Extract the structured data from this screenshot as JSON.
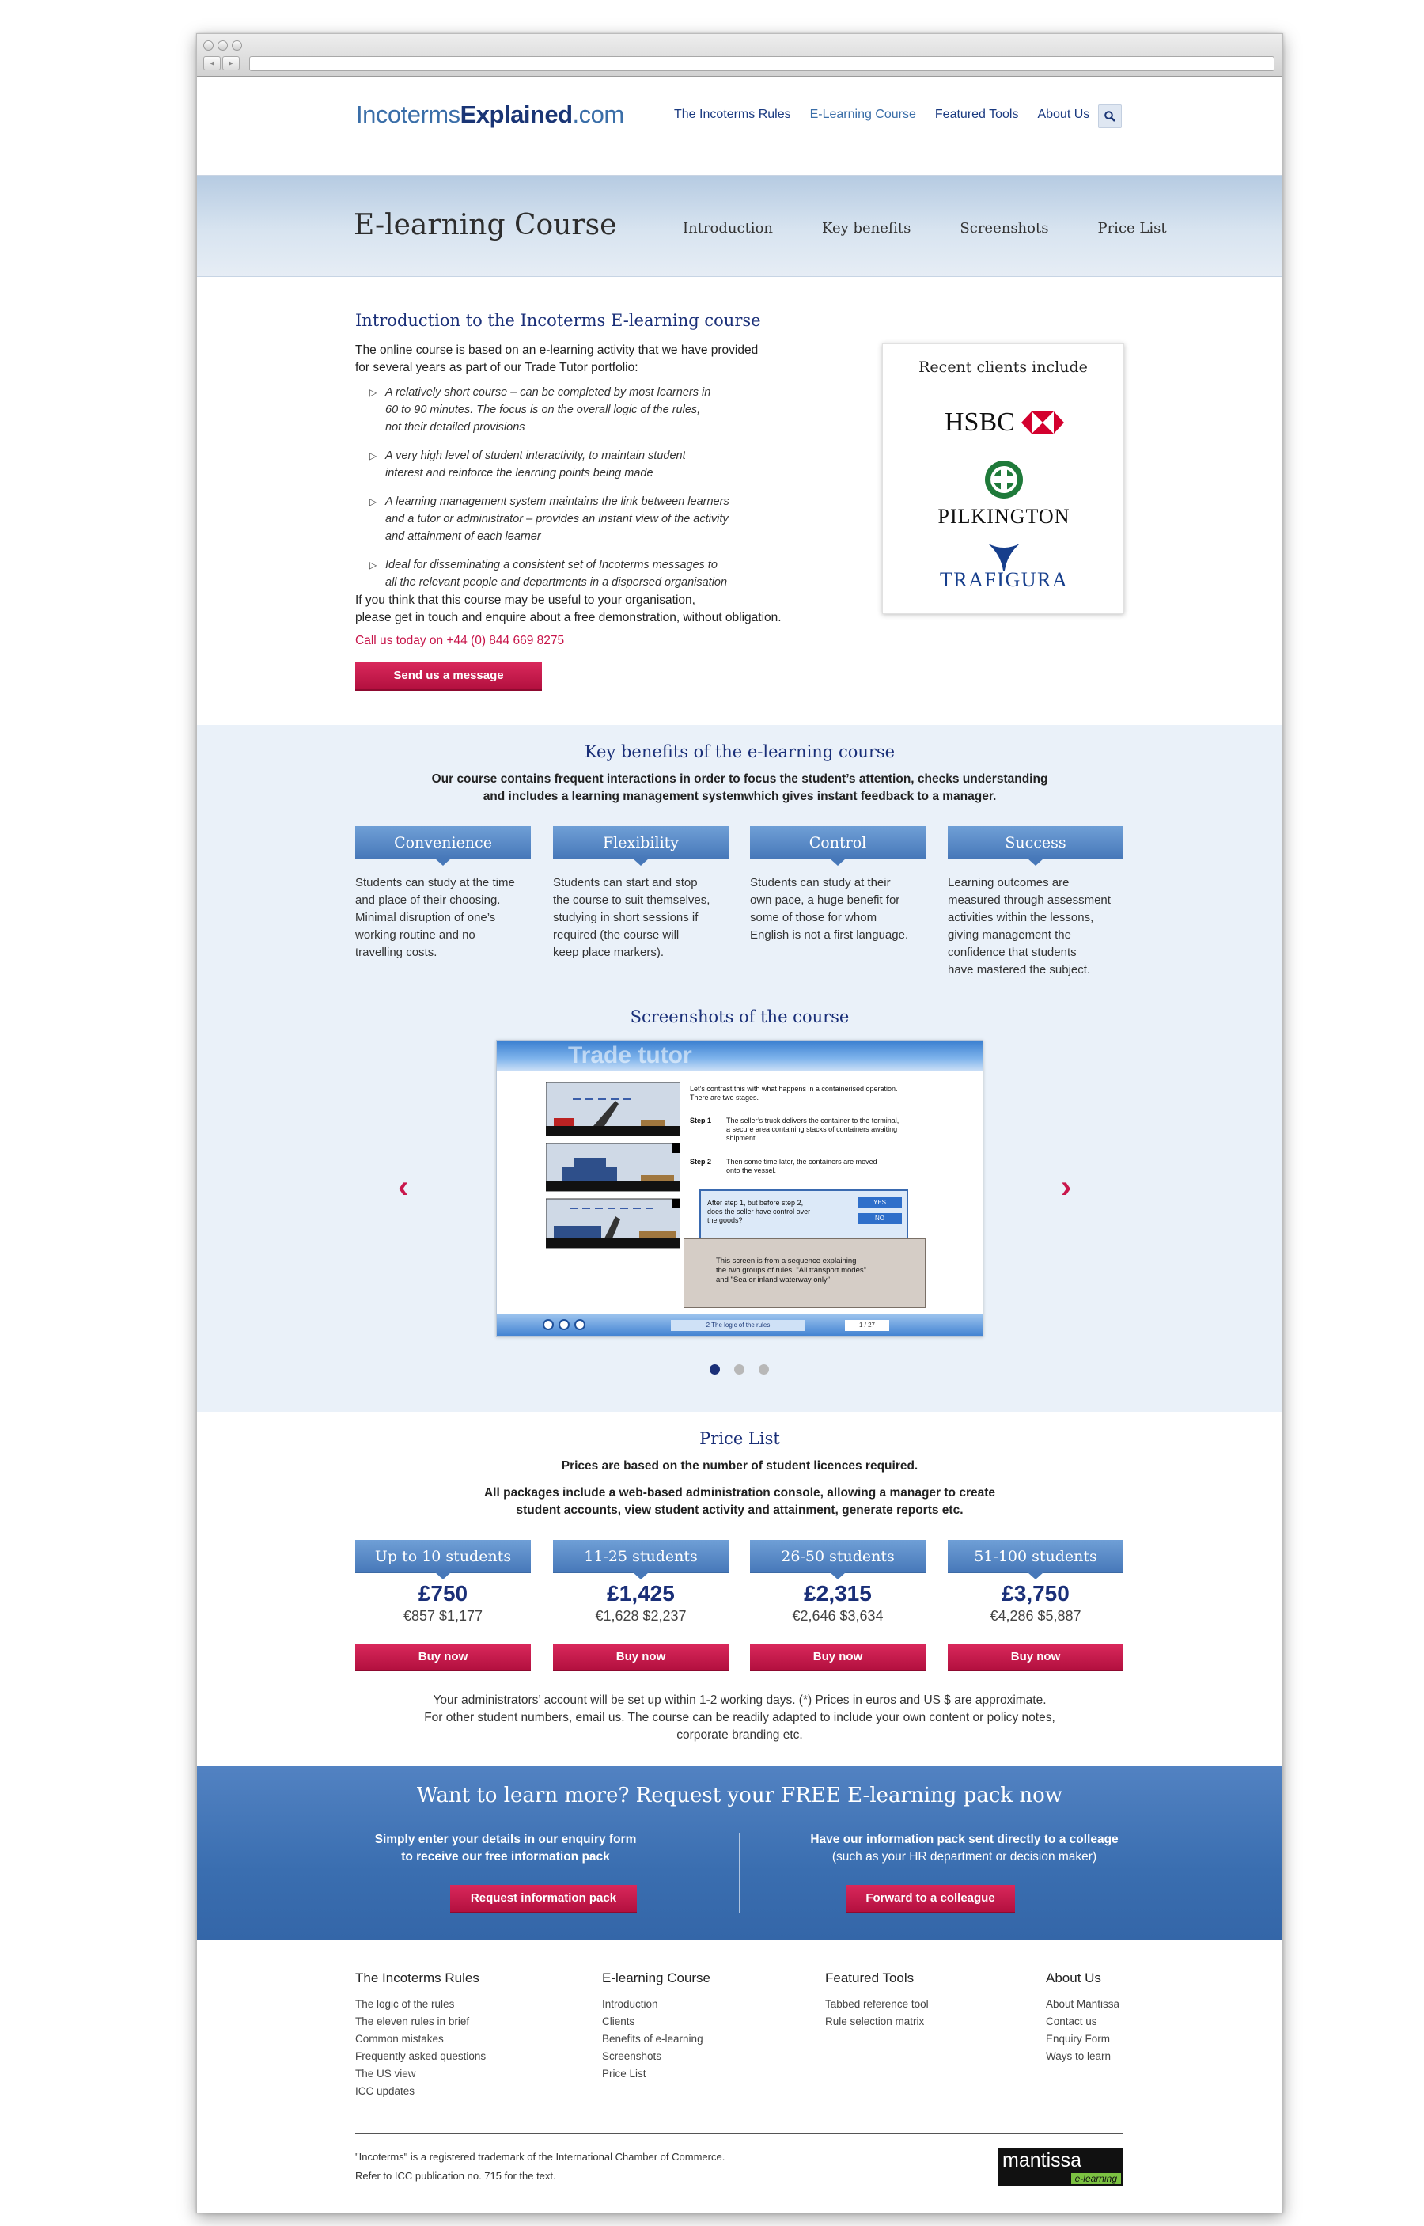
{
  "logo": {
    "part1": "Incoterms",
    "part2": "Explained",
    "part3": ".com"
  },
  "topnav": {
    "items": [
      "The Incoterms Rules",
      "E-Learning Course",
      "Featured Tools",
      "About Us"
    ]
  },
  "banner": {
    "title": "E-learning Course",
    "subnav": [
      "Introduction",
      "Key benefits",
      "Screenshots",
      "Price List"
    ]
  },
  "intro": {
    "heading": "Introduction to the Incoterms E-learning course",
    "lead_1": "The online course is based on an e-learning activity that we have provided",
    "lead_2": "for several years as part of our Trade Tutor portfolio:",
    "bullets": [
      [
        "A relatively short course – can be completed by most learners in",
        "60 to 90 minutes. The focus is on the overall logic of the rules,",
        "not their detailed provisions"
      ],
      [
        "A very high level of student interactivity, to maintain student",
        "interest and reinforce the learning points being made"
      ],
      [
        "A learning management system maintains the link between learners",
        "and a tutor or administrator – provides an instant view of the activity",
        "and attainment of each learner"
      ],
      [
        "Ideal for disseminating a consistent set of Incoterms messages to",
        "all the relevant people and departments in a dispersed organisation"
      ]
    ],
    "outro_1": "If you think that this course may be useful to your organisation,",
    "outro_2": "please get in touch and enquire about a free demonstration, without obligation.",
    "call": "Call us today on +44 (0) 844 669 8275",
    "send_button": "Send us a message"
  },
  "clients": {
    "title": "Recent clients include",
    "names": [
      "HSBC",
      "PILKINGTON",
      "TRAFIGURA"
    ]
  },
  "benefits": {
    "heading": "Key benefits of the e-learning course",
    "lead_1": "Our course contains frequent interactions in order to focus the student’s attention, checks understanding",
    "lead_2": "and includes a learning management systemwhich gives instant feedback to a manager.",
    "items": [
      {
        "title": "Convenience",
        "lines": [
          "Students can study at the time",
          "and place of their choosing.",
          "Minimal disruption of one’s",
          "working routine and no",
          "travelling costs."
        ]
      },
      {
        "title": "Flexibility",
        "lines": [
          "Students can start and stop",
          "the course to suit themselves,",
          "studying in short sessions if",
          "required (the course will",
          "keep place markers)."
        ]
      },
      {
        "title": "Control",
        "lines": [
          "Students can study at their",
          "own pace, a huge benefit for",
          "some of those for whom",
          "English is not a first language."
        ]
      },
      {
        "title": "Success",
        "lines": [
          "Learning outcomes are",
          "measured through assessment",
          "activities within the lessons,",
          "giving management the",
          "confidence that students",
          "have mastered the subject."
        ]
      }
    ]
  },
  "screenshots": {
    "heading": "Screenshots of the course",
    "slide": {
      "banner": "Trade tutor",
      "intro_1": "Let’s contrast this with what happens in a containerised operation.",
      "intro_2": "There are two stages.",
      "step1_label": "Step 1",
      "step1_1": "The seller’s truck delivers the container to the terminal,",
      "step1_2": "a secure area containing stacks of containers awaiting",
      "step1_3": "shipment.",
      "step2_label": "Step 2",
      "step2_1": "Then some time later, the containers are moved",
      "step2_2": "onto the vessel.",
      "question_1": "After step 1, but before step 2,",
      "question_2": "does the seller have control over",
      "question_3": "the goods?",
      "yes": "YES",
      "no": "NO",
      "note_1": "This screen is from a sequence explaining",
      "note_2": "the two groups of rules, \"All transport modes\"",
      "note_3": "and \"Sea or inland waterway only\"",
      "footer_label": "2  The logic of the rules",
      "page": "1 / 27"
    }
  },
  "pricing": {
    "heading": "Price List",
    "lead_1": "Prices are based on the number of student licences required.",
    "lead_2": "All packages include a web-based administration console, allowing a manager to create",
    "lead_3": "student accounts, view student activity and attainment, generate reports etc.",
    "tiers": [
      {
        "label": "Up to 10 students",
        "gbp": "£750",
        "other": "€857  $1,177"
      },
      {
        "label": "11-25 students",
        "gbp": "£1,425",
        "other": "€1,628  $2,237"
      },
      {
        "label": "26-50 students",
        "gbp": "£2,315",
        "other": "€2,646  $3,634"
      },
      {
        "label": "51-100 students",
        "gbp": "£3,750",
        "other": "€4,286  $5,887"
      }
    ],
    "buy_label": "Buy now",
    "note_1": "Your administrators’ account will be set up within 1-2 working days. (*) Prices in euros and US $ are approximate.",
    "note_2": "For other student numbers, email us. The course can be readily adapted to include your own content or policy notes,",
    "note_3": "corporate branding etc."
  },
  "cta": {
    "heading": "Want to learn more? Request your FREE E-learning pack now",
    "left_1": "Simply enter your details in our enquiry form",
    "left_2": "to receive our free information pack",
    "left_button": "Request information pack",
    "right_1": "Have our information pack sent directly to a colleage",
    "right_2": "(such as your HR department or decision maker)",
    "right_button": "Forward to a colleague"
  },
  "footer": {
    "cols": [
      {
        "title": "The Incoterms Rules",
        "links": [
          "The logic of the rules",
          "The eleven rules in brief",
          "Common mistakes",
          "Frequently asked questions",
          "The US view",
          "ICC updates"
        ]
      },
      {
        "title": "E-learning Course",
        "links": [
          "Introduction",
          "Clients",
          "Benefits of e-learning",
          "Screenshots",
          "Price List"
        ]
      },
      {
        "title": "Featured Tools",
        "links": [
          "Tabbed reference tool",
          "Rule selection matrix"
        ]
      },
      {
        "title": "About Us",
        "links": [
          "About Mantissa",
          "Contact us",
          "Enquiry Form",
          "Ways to learn"
        ]
      }
    ],
    "legal_1": "\"Incoterms\" is a registered trademark of the International Chamber of Commerce.",
    "legal_2": "Refer to ICC publication no. 715 for the text.",
    "brand": "mantissa",
    "brand_sub": "e-learning"
  },
  "colors": {
    "navy": "#1a2f78",
    "accent_red": "#c7154a",
    "ribbon_blue": "#4f82c2"
  }
}
